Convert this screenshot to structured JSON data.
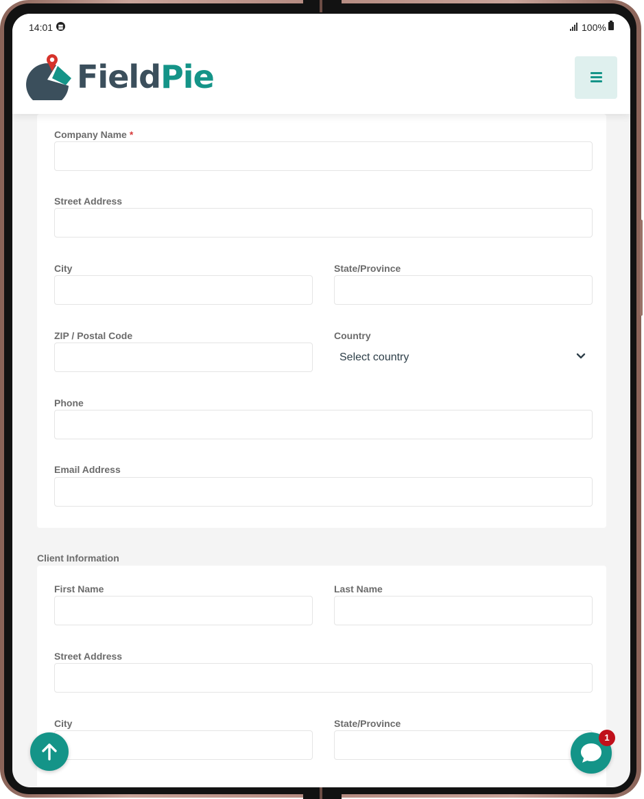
{
  "status_bar": {
    "time": "14:01",
    "battery": "100%"
  },
  "header": {
    "brand_part1": "Field",
    "brand_part2": "Pie"
  },
  "colors": {
    "accent": "#149488",
    "brand_dark": "#3b4f5c",
    "pin_red": "#d6332b",
    "badge_red": "#c0101b",
    "required_star": "#d73a3a"
  },
  "company_section": {
    "company_name_label": "Company Name",
    "required_marker": "*",
    "street_address_label": "Street Address",
    "city_label": "City",
    "state_label": "State/Province",
    "zip_label": "ZIP / Postal Code",
    "country_label": "Country",
    "country_selected": "Select country",
    "phone_label": "Phone",
    "email_label": "Email Address"
  },
  "client_section": {
    "title": "Client Information",
    "first_name_label": "First Name",
    "last_name_label": "Last Name",
    "street_address_label": "Street Address",
    "city_label": "City",
    "state_label": "State/Province"
  },
  "chat": {
    "badge_count": "1"
  },
  "icons": [
    "spotify-icon",
    "signal-icon",
    "battery-icon",
    "logo-icon",
    "menu-icon",
    "chevron-down-icon",
    "arrow-up-icon",
    "chat-icon"
  ]
}
